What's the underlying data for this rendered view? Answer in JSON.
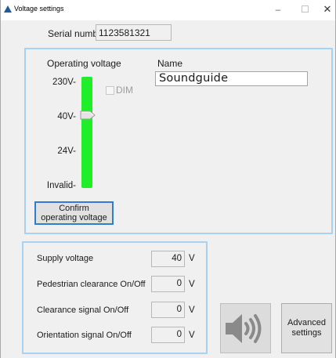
{
  "window": {
    "title": "Voltage settings",
    "minimize_glyph": "–",
    "close_glyph": "✕",
    "icon": "app-triangle-icon"
  },
  "serial": {
    "label": "Serial number",
    "value": "1123581321"
  },
  "operating_voltage": {
    "label": "Operating voltage",
    "levels": [
      "230V-",
      "40V-",
      "24V-",
      "Invalid-"
    ],
    "selected": "40V",
    "track_color": "#1fef28",
    "dim_label": "DIM",
    "dim_checked": false,
    "confirm_line1": "Confirm",
    "confirm_line2": "operating voltage"
  },
  "name": {
    "label": "Name",
    "value": "Soundguide"
  },
  "supply": {
    "rows": [
      {
        "label": "Supply voltage",
        "value": "40",
        "unit": "V"
      },
      {
        "label": "Pedestrian clearance On/Off",
        "value": "0",
        "unit": "V"
      },
      {
        "label": "Clearance signal On/Off",
        "value": "0",
        "unit": "V"
      },
      {
        "label": "Orientation signal On/Off",
        "value": "0",
        "unit": "V"
      }
    ]
  },
  "buttons": {
    "sound_icon": "speaker-icon",
    "advanced_line1": "Advanced",
    "advanced_line2": "settings"
  },
  "colors": {
    "group_border": "#a7d2f1",
    "focus_border": "#2d7dd2"
  }
}
